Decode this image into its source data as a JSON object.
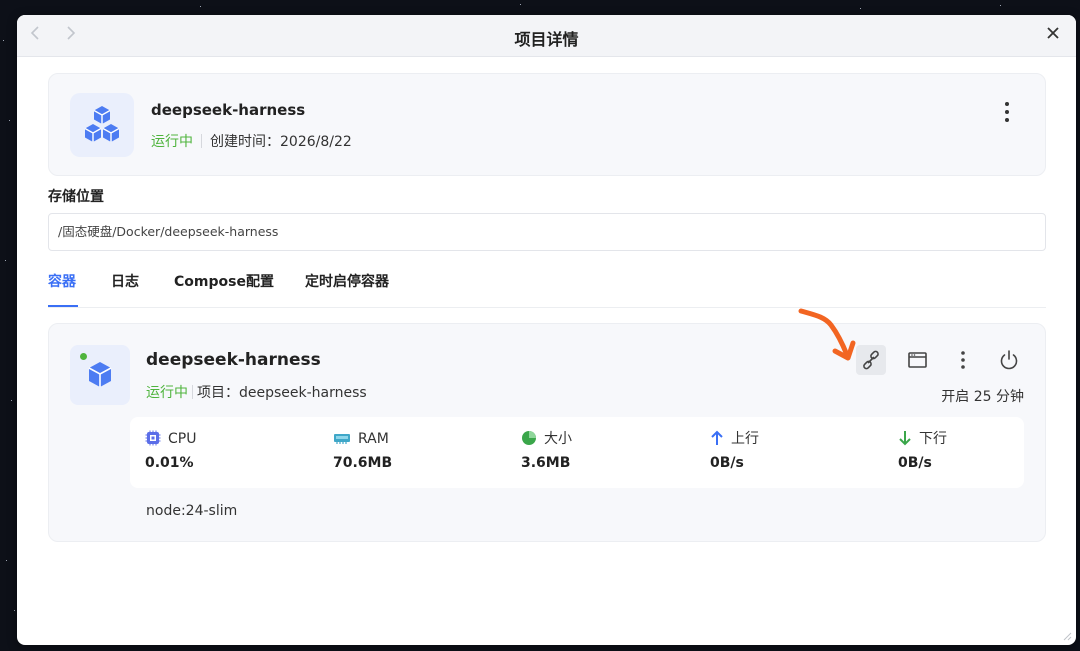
{
  "window": {
    "title": "项目详情",
    "back_icon": "chevron-left-icon",
    "forward_icon": "chevron-right-icon",
    "close_icon": "close-icon"
  },
  "project": {
    "name": "deepseek-harness",
    "status": "运行中",
    "created": "创建时间：2026/8/22",
    "icon": "cubes-icon",
    "menu_icon": "kebab-icon"
  },
  "storage": {
    "label": "存储位置",
    "path": "/固态硬盘/Docker/deepseek-harness"
  },
  "tabs": [
    {
      "label": "容器",
      "active": true
    },
    {
      "label": "日志",
      "active": false
    },
    {
      "label": "Compose配置",
      "active": false
    },
    {
      "label": "定时启停容器",
      "active": false
    }
  ],
  "container": {
    "name": "deepseek-harness",
    "status": "运行中",
    "project": "项目：deepseek-harness",
    "uptime": "开启 25 分钟",
    "image": "node:24-slim",
    "actions": [
      "link-icon",
      "terminal-icon",
      "kebab-icon",
      "power-icon"
    ],
    "stats": [
      {
        "label": "CPU",
        "value": "0.01%",
        "icon": "cpu-icon"
      },
      {
        "label": "RAM",
        "value": "70.6MB",
        "icon": "ram-icon"
      },
      {
        "label": "大小",
        "value": "3.6MB",
        "icon": "pie-icon"
      },
      {
        "label": "上行",
        "value": "0B/s",
        "icon": "arrow-up-icon"
      },
      {
        "label": "下行",
        "value": "0B/s",
        "icon": "arrow-down-icon"
      }
    ]
  },
  "colors": {
    "accent": "#3a6ff5",
    "running": "#4fb43d",
    "annotation": "#f26522"
  }
}
